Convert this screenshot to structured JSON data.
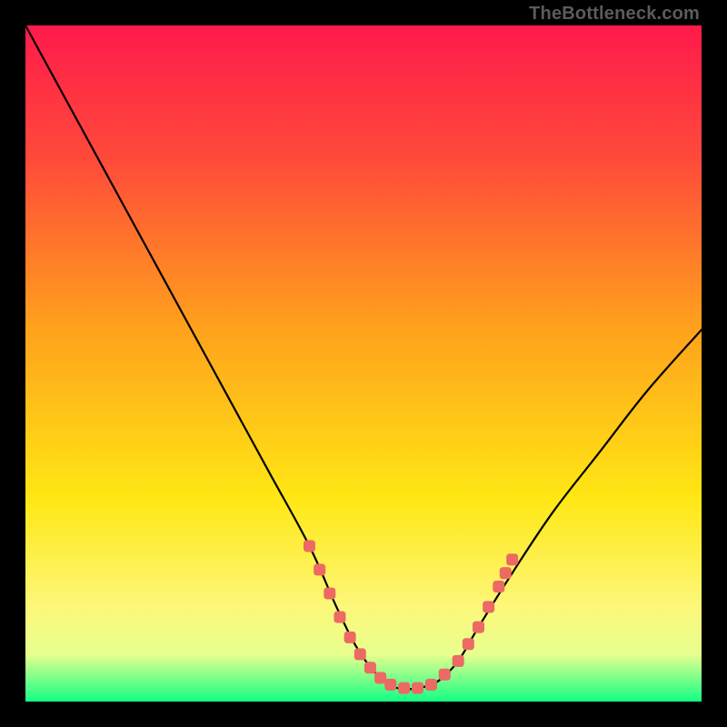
{
  "watermark": "TheBottleneck.com",
  "chart_data": {
    "type": "line",
    "title": "",
    "xlabel": "",
    "ylabel": "",
    "xlim": [
      0,
      100
    ],
    "ylim": [
      0,
      100
    ],
    "gradient_stops": [
      {
        "offset": 0,
        "color": "#ff1a4b"
      },
      {
        "offset": 20,
        "color": "#ff4b3a"
      },
      {
        "offset": 45,
        "color": "#ffa21c"
      },
      {
        "offset": 70,
        "color": "#ffe714"
      },
      {
        "offset": 86,
        "color": "#fdf77a"
      },
      {
        "offset": 93,
        "color": "#e7ff8e"
      },
      {
        "offset": 100,
        "color": "#13ff85"
      }
    ],
    "series": [
      {
        "name": "bottleneck-curve",
        "x": [
          0,
          6,
          12,
          18,
          24,
          30,
          36,
          42,
          46,
          49,
          52,
          55,
          58,
          61,
          64,
          67,
          72,
          78,
          85,
          92,
          100
        ],
        "values": [
          100,
          89,
          78,
          67,
          56,
          45,
          34,
          23,
          14,
          8,
          4,
          2,
          2,
          3,
          6,
          11,
          19,
          28,
          37,
          46,
          55
        ]
      }
    ],
    "markers": {
      "name": "sweet-spot",
      "color": "#ec6a63",
      "points": [
        {
          "x": 42.0,
          "y": 23.0
        },
        {
          "x": 43.5,
          "y": 19.5
        },
        {
          "x": 45.0,
          "y": 16.0
        },
        {
          "x": 46.5,
          "y": 12.5
        },
        {
          "x": 48.0,
          "y": 9.5
        },
        {
          "x": 49.5,
          "y": 7.0
        },
        {
          "x": 51.0,
          "y": 5.0
        },
        {
          "x": 52.5,
          "y": 3.5
        },
        {
          "x": 54.0,
          "y": 2.5
        },
        {
          "x": 56.0,
          "y": 2.0
        },
        {
          "x": 58.0,
          "y": 2.0
        },
        {
          "x": 60.0,
          "y": 2.5
        },
        {
          "x": 62.0,
          "y": 4.0
        },
        {
          "x": 64.0,
          "y": 6.0
        },
        {
          "x": 65.5,
          "y": 8.5
        },
        {
          "x": 67.0,
          "y": 11.0
        },
        {
          "x": 68.5,
          "y": 14.0
        },
        {
          "x": 70.0,
          "y": 17.0
        },
        {
          "x": 71.0,
          "y": 19.0
        },
        {
          "x": 72.0,
          "y": 21.0
        }
      ]
    }
  }
}
